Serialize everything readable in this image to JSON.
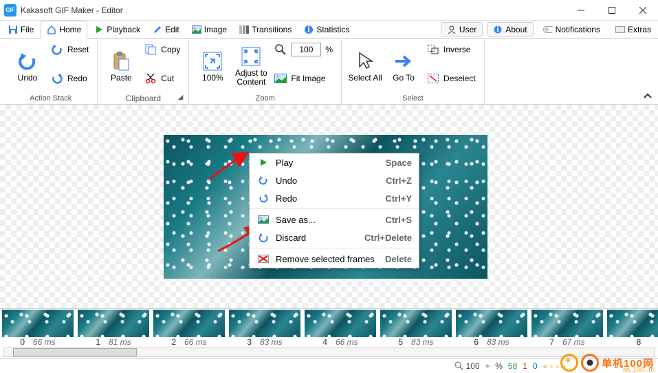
{
  "window": {
    "title": "Kakasoft GIF Maker - Editor",
    "app_badge": "GIF"
  },
  "menu_tabs": {
    "file": "File",
    "home": "Home",
    "playback": "Playback",
    "edit": "Edit",
    "image": "Image",
    "transitions": "Transitions",
    "statistics": "Statistics"
  },
  "right_tabs": {
    "user": "User",
    "about": "About",
    "notifications": "Notifications",
    "extras": "Extras"
  },
  "ribbon": {
    "action_stack": {
      "label": "Action Stack",
      "undo": "Undo",
      "reset": "Reset",
      "redo": "Redo"
    },
    "clipboard": {
      "label": "Clipboard",
      "paste": "Paste",
      "copy": "Copy",
      "cut": "Cut"
    },
    "zoom": {
      "label": "Zoom",
      "hundred": "100%",
      "adjust": "Adjust to Content",
      "value": "100",
      "pct": "%",
      "fit": "Fit Image"
    },
    "select": {
      "label": "Select",
      "all": "Select All",
      "goto": "Go To",
      "inverse": "Inverse",
      "deselect": "Deselect"
    }
  },
  "context_menu": [
    {
      "icon": "play",
      "label": "Play",
      "shortcut": "Space"
    },
    {
      "icon": "undo",
      "label": "Undo",
      "shortcut": "Ctrl+Z"
    },
    {
      "icon": "redo",
      "label": "Redo",
      "shortcut": "Ctrl+Y"
    },
    {
      "sep": true
    },
    {
      "icon": "saveas",
      "label": "Save as...",
      "shortcut": "Ctrl+S"
    },
    {
      "icon": "discard",
      "label": "Discard",
      "shortcut": "Ctrl+Delete"
    },
    {
      "sep": true
    },
    {
      "icon": "remove",
      "label": "Remove selected frames",
      "shortcut": "Delete"
    }
  ],
  "frames": [
    {
      "i": "0",
      "ms": "66 ms"
    },
    {
      "i": "1",
      "ms": "81 ms"
    },
    {
      "i": "2",
      "ms": "66 ms"
    },
    {
      "i": "3",
      "ms": "83 ms"
    },
    {
      "i": "4",
      "ms": "66 ms"
    },
    {
      "i": "5",
      "ms": "83 ms"
    },
    {
      "i": "6",
      "ms": "83 ms"
    },
    {
      "i": "7",
      "ms": "67 ms"
    },
    {
      "i": "8",
      "ms": ""
    }
  ],
  "status": {
    "zoom": "100",
    "divider": "÷",
    "pct": "%",
    "n1": "58",
    "n2": "1",
    "n3": "0"
  },
  "watermark": {
    "txt": "单机100网",
    "sub": "da..100...m"
  }
}
